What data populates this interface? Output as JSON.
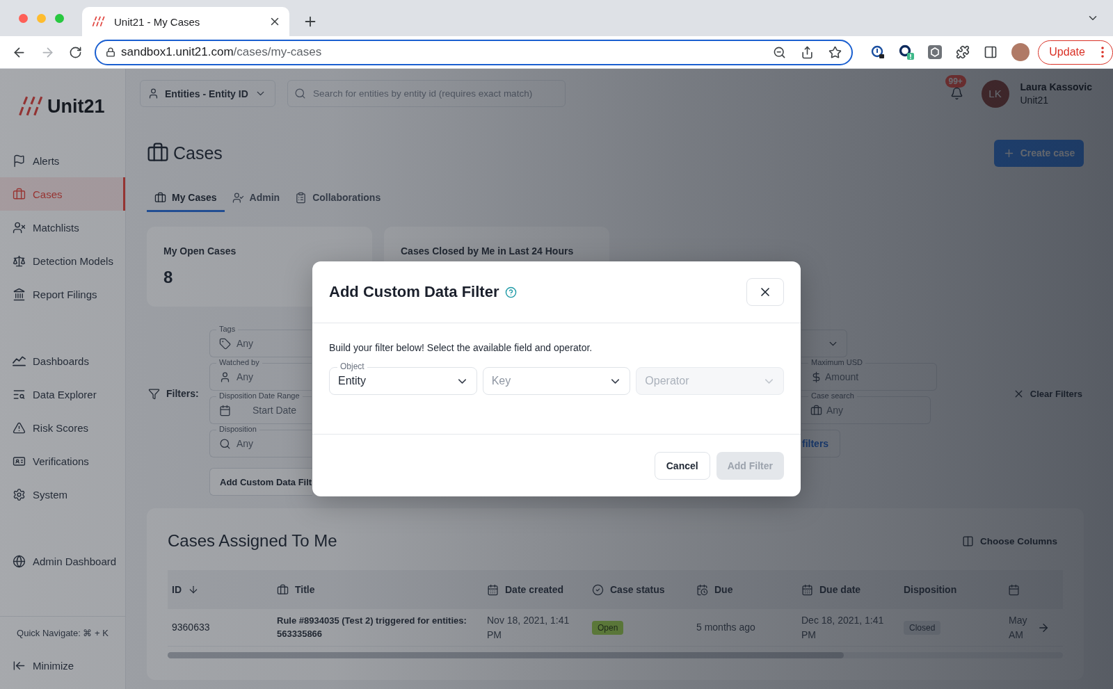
{
  "browser": {
    "tab_title": "Unit21 - My Cases",
    "url": {
      "host": "sandbox1.unit21.com",
      "path": "/cases/my-cases"
    },
    "update_button": "Update"
  },
  "sidebar": {
    "logo": "Unit21",
    "groups": [
      {
        "items": [
          {
            "label": "Alerts",
            "selected": false
          },
          {
            "label": "Cases",
            "selected": true
          },
          {
            "label": "Matchlists",
            "selected": false
          },
          {
            "label": "Detection Models",
            "selected": false
          },
          {
            "label": "Report Filings",
            "selected": false
          }
        ]
      },
      {
        "items": [
          {
            "label": "Dashboards",
            "selected": false
          },
          {
            "label": "Data Explorer",
            "selected": false
          },
          {
            "label": "Risk Scores",
            "selected": false
          },
          {
            "label": "Verifications",
            "selected": false
          },
          {
            "label": "System",
            "selected": false
          }
        ]
      },
      {
        "items": [
          {
            "label": "Admin Dashboard",
            "selected": false
          }
        ]
      }
    ],
    "quick_navigate": "Quick Navigate: ⌘ + K",
    "minimize": "Minimize"
  },
  "top_bar": {
    "search_scope": "Entities - Entity ID",
    "search": {
      "placeholder": "Search for entities by entity id (requires exact match)"
    },
    "notification_badge": "99+",
    "user": {
      "initials": "LK",
      "name": "Laura Kassovic",
      "org": "Unit21"
    }
  },
  "page": {
    "title": "Cases",
    "create_button": "Create case",
    "tabs": [
      {
        "label": "My Cases",
        "selected": true
      },
      {
        "label": "Admin",
        "selected": false
      },
      {
        "label": "Collaborations",
        "selected": false
      }
    ],
    "stats": [
      {
        "label": "My Open Cases",
        "value": "8"
      },
      {
        "label": "Cases Closed by Me in Last 24 Hours"
      }
    ]
  },
  "filters": {
    "label": "Filters:",
    "fields": [
      {
        "kind": "tags",
        "label": "Tags",
        "placeholder": "Any"
      },
      {
        "kind": "people",
        "label": "Watched by",
        "placeholder": "Any"
      },
      {
        "kind": "date_range",
        "label": "Disposition Date Range",
        "placeholder": "Start Date"
      },
      {
        "kind": "search",
        "label": "Disposition",
        "placeholder": "Any"
      }
    ],
    "add_custom_button": "Add Custom Data Filt",
    "right_fields": [
      {
        "kind": "amount",
        "label": "Maximum USD",
        "placeholder": "Amount"
      },
      {
        "kind": "case",
        "label": "Case search",
        "placeholder": "Any"
      }
    ],
    "more_button": "filters",
    "clear_button": "Clear Filters"
  },
  "cases_table": {
    "title": "Cases Assigned To Me",
    "choose_columns": "Choose Columns",
    "columns": [
      "ID",
      "Title",
      "Date created",
      "Case status",
      "Due",
      "Due date",
      "Disposition"
    ],
    "rows": [
      {
        "id": "9360633",
        "title": "Rule #8934035 (Test 2) triggered for entities: 563335866",
        "date_created": "Nov 18, 2021, 1:41 PM",
        "case_status": {
          "text": "Open",
          "kind": "success"
        },
        "due": "5 months ago",
        "due_date": "Dec 18, 2021, 1:41 PM",
        "disposition": {
          "text": "Closed",
          "kind": "neutral"
        },
        "column_8": "May AM"
      }
    ]
  },
  "modal": {
    "title": "Add Custom Data Filter",
    "description": "Build your filter below! Select the available field and operator.",
    "selects": [
      {
        "label": "Object",
        "value": "Entity",
        "disabled": false
      },
      {
        "placeholder": "Key",
        "disabled": false
      },
      {
        "placeholder": "Operator",
        "disabled": true
      }
    ],
    "buttons": [
      {
        "label": "Cancel",
        "kind": "secondary",
        "disabled": false
      },
      {
        "label": "Add Filter",
        "kind": "primary",
        "disabled": true
      }
    ]
  }
}
